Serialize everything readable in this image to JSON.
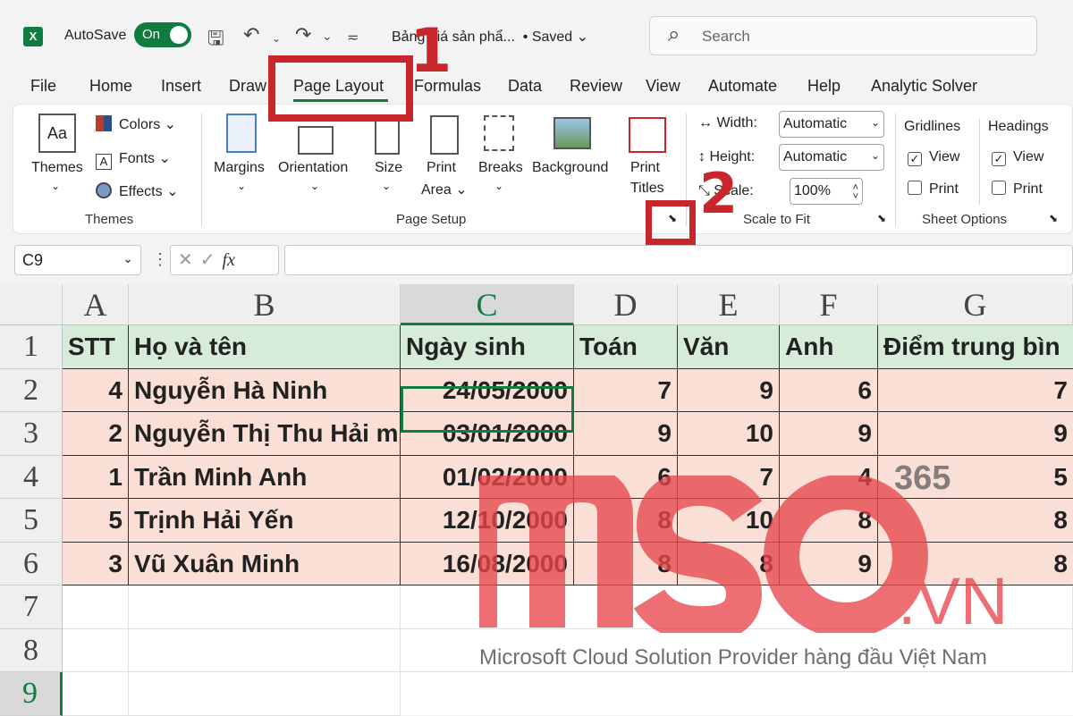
{
  "titlebar": {
    "app_icon": "X",
    "autosave_label": "AutoSave",
    "autosave_state": "On",
    "doc_title": "Bảng giá sản phẩ...",
    "saved_status": "• Saved",
    "search_placeholder": "Search"
  },
  "tabs": [
    "File",
    "Home",
    "Insert",
    "Draw",
    "Page Layout",
    "Formulas",
    "Data",
    "Review",
    "View",
    "Automate",
    "Help",
    "Analytic Solver"
  ],
  "active_tab": "Page Layout",
  "ribbon": {
    "themes": {
      "themes_label": "Themes",
      "colors_label": "Colors",
      "fonts_label": "Fonts",
      "effects_label": "Effects",
      "group_label": "Themes"
    },
    "page_setup": {
      "margins_label": "Margins",
      "orientation_label": "Orientation",
      "size_label": "Size",
      "print_area_label_1": "Print",
      "print_area_label_2": "Area",
      "breaks_label": "Breaks",
      "background_label": "Background",
      "print_titles_label_1": "Print",
      "print_titles_label_2": "Titles",
      "group_label": "Page Setup"
    },
    "scale_to_fit": {
      "width_label": "Width:",
      "width_value": "Automatic",
      "height_label": "Height:",
      "height_value": "Automatic",
      "scale_label": "Scale:",
      "scale_value": "100%",
      "group_label": "Scale to Fit"
    },
    "sheet_options": {
      "gridlines_label": "Gridlines",
      "headings_label": "Headings",
      "view_label": "View",
      "print_label": "Print",
      "group_label": "Sheet Options"
    }
  },
  "formula_bar": {
    "name_box": "C9",
    "fx": "fx"
  },
  "columns": [
    "A",
    "B",
    "C",
    "D",
    "E",
    "F",
    "G"
  ],
  "rows": [
    "1",
    "2",
    "3",
    "4",
    "5",
    "6",
    "7",
    "8",
    "9"
  ],
  "table": {
    "headers": [
      "STT",
      "Họ và tên",
      "Ngày sinh",
      "Toán",
      "Văn",
      "Anh",
      "Điểm trung bìn"
    ],
    "rows": [
      [
        "4",
        "Nguyễn Hà Ninh",
        "24/05/2000",
        "7",
        "9",
        "6",
        "7"
      ],
      [
        "2",
        "Nguyễn Thị Thu Hải m",
        "03/01/2000",
        "9",
        "10",
        "9",
        "9"
      ],
      [
        "1",
        "Trần Minh Anh",
        "01/02/2000",
        "6",
        "7",
        "4",
        "5"
      ],
      [
        "5",
        "Trịnh Hải Yến",
        "12/10/2000",
        "8",
        "10",
        "8",
        "8"
      ],
      [
        "3",
        "Vũ Xuân Minh",
        "16/08/2000",
        "8",
        "8",
        "9",
        "8"
      ]
    ]
  },
  "annotations": {
    "step1": "1",
    "step2": "2"
  },
  "watermark": {
    "logo": "mso",
    "suffix": ".VN",
    "badge": "365",
    "tagline": "Microsoft Cloud Solution Provider hàng đầu Việt Nam",
    "color": "#e8474c"
  }
}
